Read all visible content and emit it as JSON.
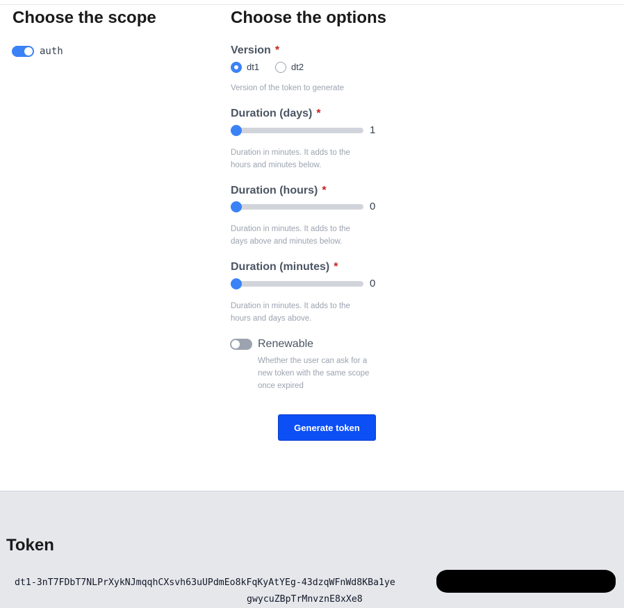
{
  "scope": {
    "title": "Choose the scope",
    "items": [
      {
        "label": "auth",
        "enabled": true
      }
    ]
  },
  "options": {
    "title": "Choose the options",
    "version": {
      "label": "Version",
      "required_mark": "*",
      "options": [
        {
          "label": "dt1",
          "selected": true
        },
        {
          "label": "dt2",
          "selected": false
        }
      ],
      "help": "Version of the token to generate"
    },
    "duration_days": {
      "label": "Duration (days)",
      "required_mark": "*",
      "value": "1",
      "fraction": 0,
      "help": "Duration in minutes. It adds to the hours and minutes below."
    },
    "duration_hours": {
      "label": "Duration (hours)",
      "required_mark": "*",
      "value": "0",
      "fraction": 0,
      "help": "Duration in minutes. It adds to the days above and minutes below."
    },
    "duration_minutes": {
      "label": "Duration (minutes)",
      "required_mark": "*",
      "value": "0",
      "fraction": 0,
      "help": "Duration in minutes. It adds to the hours and days above."
    },
    "renewable": {
      "label": "Renewable",
      "enabled": false,
      "help": "Whether the user can ask for a new token with the same scope once expired"
    },
    "generate_label": "Generate token"
  },
  "token": {
    "title": "Token",
    "line1": "dt1-3nT7FDbT7NLPrXykNJmqqhCXsvh63uUPdmEo8kFqKyAtYEg-43dzqWFnWd8KBa1ye",
    "line2": "gwycuZBpTrMnvznE8xXe8"
  },
  "colors": {
    "accent": "#3b82f6",
    "button": "#0b4ff5",
    "required": "#c81e1e",
    "panel": "#e5e7eb"
  }
}
